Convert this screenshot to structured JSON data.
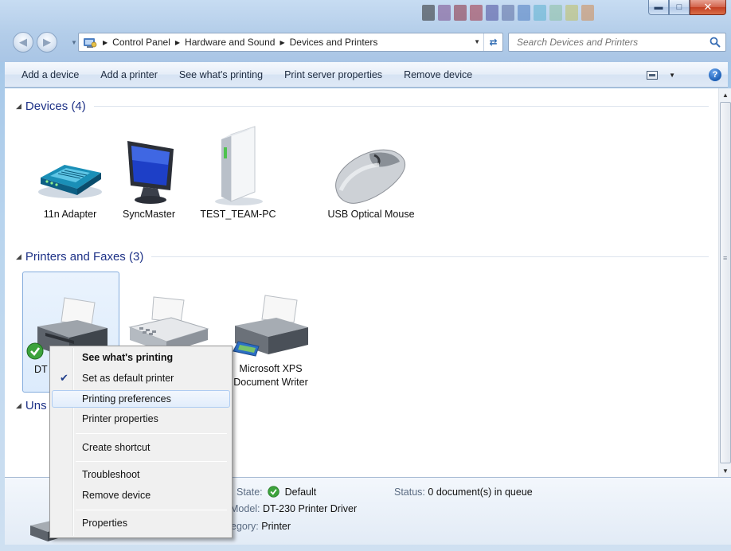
{
  "window": {
    "breadcrumbs": [
      "Control Panel",
      "Hardware and Sound",
      "Devices and Printers"
    ],
    "search_placeholder": "Search Devices and Printers"
  },
  "toolbar": {
    "commands": [
      "Add a device",
      "Add a printer",
      "See what's printing",
      "Print server properties",
      "Remove device"
    ]
  },
  "groups": {
    "devices": {
      "header": "Devices (4)",
      "items": [
        {
          "label": "11n Adapter",
          "icon": "router-icon"
        },
        {
          "label": "SyncMaster",
          "icon": "monitor-icon"
        },
        {
          "label": "TEST_TEAM-PC",
          "icon": "computer-tower-icon"
        },
        {
          "label": "USB Optical Mouse",
          "icon": "mouse-icon"
        }
      ]
    },
    "printers": {
      "header": "Printers and Faxes (3)",
      "items": [
        {
          "label": "DT",
          "icon": "printer-icon",
          "selected": true,
          "default": true
        },
        {
          "label": "",
          "icon": "fax-icon"
        },
        {
          "label": "Microsoft XPS Document Writer",
          "icon": "printer-icon"
        }
      ]
    },
    "unspecified": {
      "header": "Uns"
    }
  },
  "context_menu": {
    "items": [
      {
        "label": "See what's printing",
        "bold": true
      },
      {
        "label": "Set as default printer",
        "checked": true
      },
      {
        "label": "Printing preferences",
        "hover": true
      },
      {
        "label": "Printer properties"
      },
      {
        "label": "Create shortcut"
      },
      {
        "label": "Troubleshoot"
      },
      {
        "label": "Remove device"
      },
      {
        "label": "Properties"
      }
    ]
  },
  "details": {
    "state_label": "State:",
    "state_value": "Default",
    "status_label": "Status:",
    "status_value": "0 document(s) in queue",
    "model_label": "Model:",
    "model_value": "DT-230 Printer Driver",
    "category_label": "egory:",
    "category_value": "Printer"
  }
}
